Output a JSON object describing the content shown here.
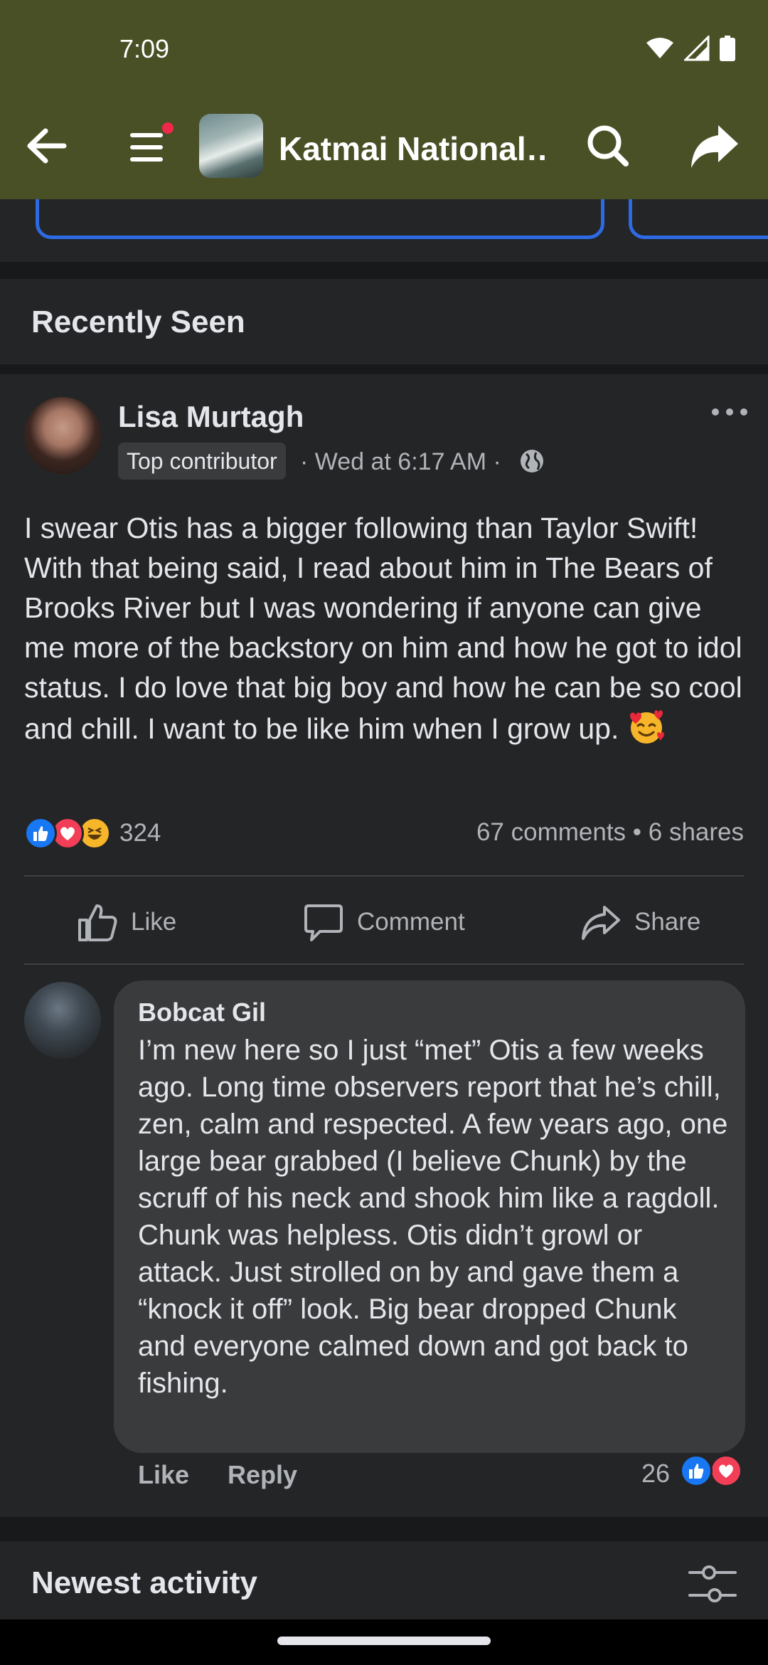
{
  "status_bar": {
    "time": "7:09"
  },
  "app_bar": {
    "group_title": "Katmai National…"
  },
  "sections": {
    "recently_seen": "Recently Seen",
    "newest_activity": "Newest activity"
  },
  "post": {
    "author": "Lisa Murtagh",
    "badge": "Top contributor",
    "meta": "· Wed at 6:17 AM ·",
    "text": "I swear Otis has a bigger following than Taylor Swift!  With that being said, I read about him in The Bears of Brooks River but I was wondering if anyone can give me more of the backstory on him and how he got to idol status. I do love that big boy and how he can be so cool and chill. I want to be like him when I grow up.",
    "reaction_count": "324",
    "engagement": "67 comments • 6 shares",
    "actions": {
      "like": "Like",
      "comment": "Comment",
      "share": "Share"
    }
  },
  "comment": {
    "author": "Bobcat Gil",
    "text": "I’m new here so I just “met” Otis a few weeks ago.  Long time observers report that he’s chill, zen, calm and respected.  A few years ago, one large bear grabbed (I believe Chunk) by the scruff of his neck and shook him like a ragdoll.  Chunk was helpless.  Otis didn’t growl or attack.  Just strolled on by and gave them a “knock it off” look.  Big bear dropped Chunk and everyone calmed down and got back to fishing.",
    "like": "Like",
    "reply": "Reply",
    "reaction_count": "26"
  },
  "colors": {
    "app_bar": "#4a5026",
    "accent": "#2d6ae3",
    "surface": "#242526",
    "background": "#18191a",
    "like_blue": "#1877f2",
    "love_red": "#f33e58"
  }
}
